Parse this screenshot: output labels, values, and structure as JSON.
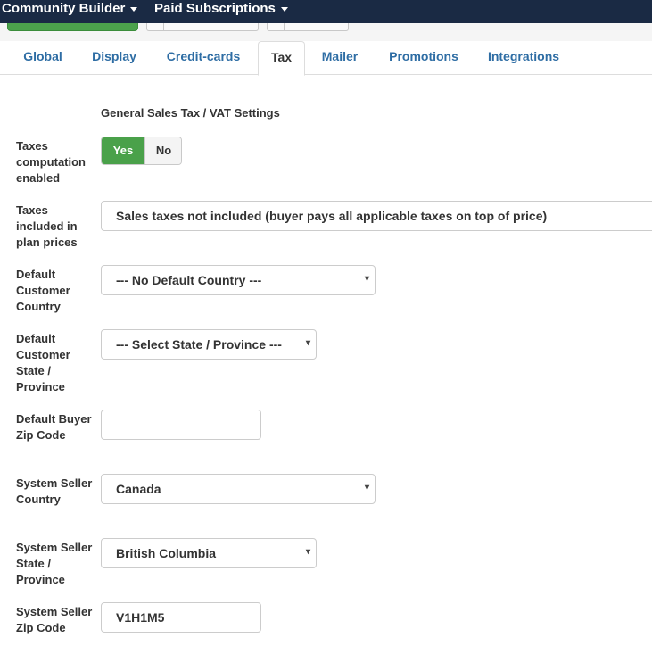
{
  "topbar": {
    "menus": [
      {
        "label": "Community Builder"
      },
      {
        "label": "Paid Subscriptions"
      }
    ]
  },
  "tabs": [
    {
      "label": "Global",
      "active": false
    },
    {
      "label": "Display",
      "active": false
    },
    {
      "label": "Credit-cards",
      "active": false
    },
    {
      "label": "Tax",
      "active": true
    },
    {
      "label": "Mailer",
      "active": false
    },
    {
      "label": "Promotions",
      "active": false
    },
    {
      "label": "Integrations",
      "active": false
    }
  ],
  "section_title": "General Sales Tax / VAT Settings",
  "fields": {
    "taxes_enabled": {
      "label": "Taxes computation enabled",
      "yes": "Yes",
      "no": "No",
      "selected": "Yes"
    },
    "taxes_included": {
      "label": "Taxes included in plan prices",
      "value": "Sales taxes not included (buyer pays all applicable taxes on top of price)"
    },
    "default_country": {
      "label": "Default Customer Country",
      "value": "--- No Default Country ---"
    },
    "default_state": {
      "label": "Default Customer State / Province",
      "value": "--- Select State / Province ---"
    },
    "default_zip": {
      "label": "Default Buyer Zip Code",
      "value": ""
    },
    "seller_country": {
      "label": "System Seller Country",
      "value": "Canada"
    },
    "seller_state": {
      "label": "System Seller State / Province",
      "value": "British Columbia"
    },
    "seller_zip": {
      "label": "System Seller Zip Code",
      "value": "V1H1M5"
    }
  },
  "colors": {
    "topbar": "#1a2a44",
    "accent_green": "#4aa14a",
    "tab_link": "#2e6da4"
  },
  "icons": {
    "dropdown_caret": "caret-down-icon",
    "select_arrow": "select-arrow-icon"
  }
}
